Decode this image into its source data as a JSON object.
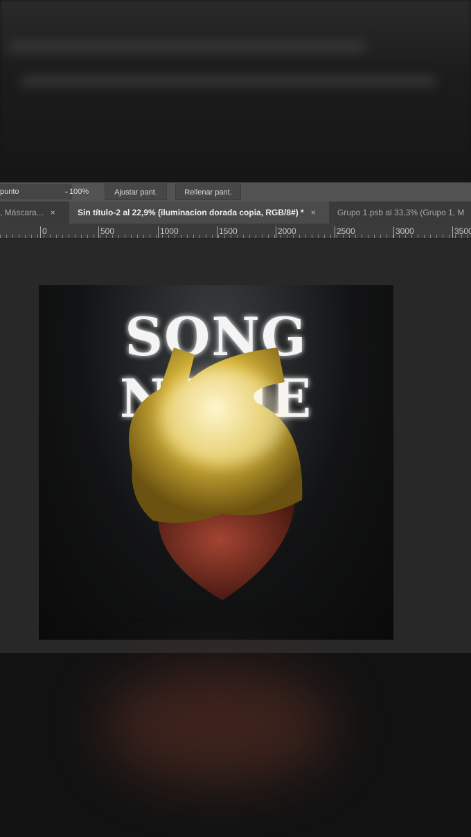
{
  "options_bar": {
    "dropdown_value": "punto",
    "zoom_value": "100%",
    "fit_screen_label": "Ajustar pant.",
    "fill_screen_label": "Rellenar pant."
  },
  "tabs": [
    {
      "label": ", Máscara...",
      "close": "×",
      "active": false
    },
    {
      "label": "Sin título-2 al 22,9% (iluminacion dorada copia, RGB/8#) *",
      "close": "×",
      "active": true
    },
    {
      "label": "Grupo 1.psb al 33,3% (Grupo 1, M",
      "active": false
    }
  ],
  "ruler": [
    "0",
    "500",
    "1000",
    "1500",
    "2000",
    "2500",
    "3000",
    "3500"
  ],
  "artwork": {
    "title_text": "SONG NAME"
  }
}
